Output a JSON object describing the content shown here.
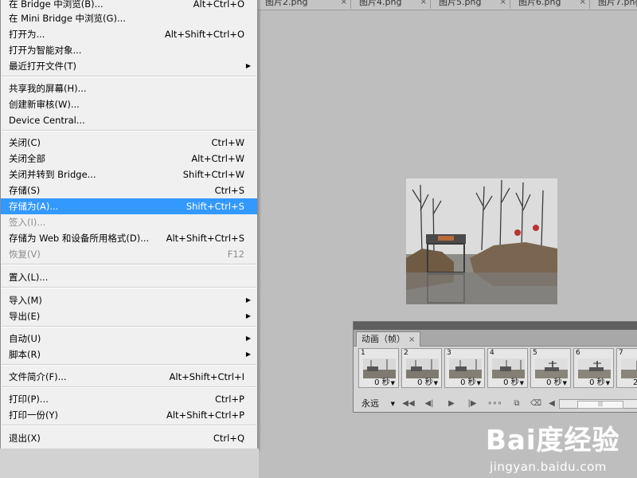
{
  "tabs": [
    {
      "label": "图片2.png"
    },
    {
      "label": "图片4.png"
    },
    {
      "label": "图片5.png"
    },
    {
      "label": "图片6.png"
    },
    {
      "label": "图片7.png"
    }
  ],
  "menu": {
    "items": [
      {
        "label": "在 Bridge 中浏览(B)...",
        "shortcut": "Alt+Ctrl+O"
      },
      {
        "label": "在 Mini Bridge 中浏览(G)...",
        "shortcut": ""
      },
      {
        "label": "打开为...",
        "shortcut": "Alt+Shift+Ctrl+O"
      },
      {
        "label": "打开为智能对象...",
        "shortcut": ""
      },
      {
        "label": "最近打开文件(T)",
        "shortcut": ""
      },
      {
        "label": "共享我的屏幕(H)...",
        "shortcut": ""
      },
      {
        "label": "创建新审核(W)...",
        "shortcut": ""
      },
      {
        "label": "Device Central...",
        "shortcut": ""
      },
      {
        "label": "关闭(C)",
        "shortcut": "Ctrl+W"
      },
      {
        "label": "关闭全部",
        "shortcut": "Alt+Ctrl+W"
      },
      {
        "label": "关闭并转到 Bridge...",
        "shortcut": "Shift+Ctrl+W"
      },
      {
        "label": "存储(S)",
        "shortcut": "Ctrl+S"
      },
      {
        "label": "存储为(A)...",
        "shortcut": "Shift+Ctrl+S"
      },
      {
        "label": "签入(I)...",
        "shortcut": ""
      },
      {
        "label": "存储为 Web 和设备所用格式(D)...",
        "shortcut": "Alt+Shift+Ctrl+S"
      },
      {
        "label": "恢复(V)",
        "shortcut": "F12"
      },
      {
        "label": "置入(L)...",
        "shortcut": ""
      },
      {
        "label": "导入(M)",
        "shortcut": ""
      },
      {
        "label": "导出(E)",
        "shortcut": ""
      },
      {
        "label": "自动(U)",
        "shortcut": ""
      },
      {
        "label": "脚本(R)",
        "shortcut": ""
      },
      {
        "label": "文件简介(F)...",
        "shortcut": "Alt+Shift+Ctrl+I"
      },
      {
        "label": "打印(P)...",
        "shortcut": "Ctrl+P"
      },
      {
        "label": "打印一份(Y)",
        "shortcut": "Alt+Shift+Ctrl+P"
      },
      {
        "label": "退出(X)",
        "shortcut": "Ctrl+Q"
      }
    ],
    "highlight_color": "#3399ff"
  },
  "animation": {
    "tab_label": "动画（帧）",
    "loop_label": "永远",
    "frames": [
      {
        "number": "1",
        "delay": "0 秒"
      },
      {
        "number": "2",
        "delay": "0 秒"
      },
      {
        "number": "3",
        "delay": "0 秒"
      },
      {
        "number": "4",
        "delay": "0 秒"
      },
      {
        "number": "5",
        "delay": "0 秒"
      },
      {
        "number": "6",
        "delay": "0 秒"
      },
      {
        "number": "7",
        "delay": "2"
      }
    ]
  },
  "watermark": {
    "logo": "Bai度经验",
    "url": "jingyan.baidu.com"
  }
}
